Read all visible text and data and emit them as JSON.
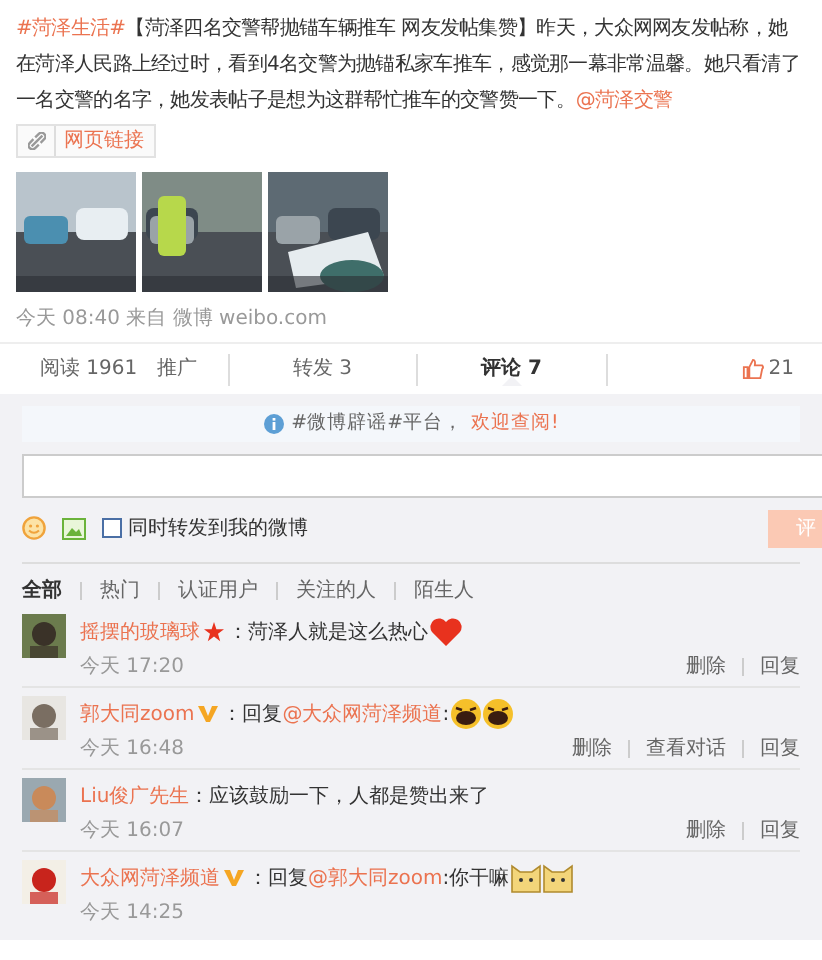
{
  "post": {
    "segments": [
      {
        "kind": "link",
        "text": "#菏泽生活#"
      },
      {
        "kind": "text",
        "text": "【菏泽四名交警帮抛锚车辆推车 网友发帖集赞】昨天，大众网网友发帖称，她在菏泽人民路上经过时，看到4名交警为抛锚私家车推车，感觉那一幕非常温馨。她只看清了一名交警的名字，她发表帖子是想为这群帮忙推车的交警赞一下。"
      },
      {
        "kind": "link",
        "text": "@菏泽交警"
      }
    ],
    "web_link": "网页链接",
    "meta": "今天 08:40 来自 微博 weibo.com"
  },
  "action_bar": {
    "reads": "阅读 1961",
    "promote": "推广",
    "tabs": [
      {
        "label": "转发 3",
        "selected": false
      },
      {
        "label": "评论 7",
        "selected": true
      }
    ],
    "likes": "21"
  },
  "notice": {
    "text": "#微博辟谣#平台，",
    "link": "欢迎查阅!"
  },
  "composer": {
    "repost_label": "同时转发到我的微博",
    "repost_checked": false,
    "submit": "评"
  },
  "filters": [
    {
      "label": "全部",
      "selected": true
    },
    {
      "label": "热门",
      "selected": false
    },
    {
      "label": "认证用户",
      "selected": false
    },
    {
      "label": "关注的人",
      "selected": false
    },
    {
      "label": "陌生人",
      "selected": false
    }
  ],
  "comments": [
    {
      "user": "摇摆的玻璃球",
      "badge": {
        "kind": "star"
      },
      "segments": [
        {
          "kind": "text",
          "text": "：菏泽人就是这么热心"
        }
      ],
      "emoji": [
        {
          "kind": "heart"
        }
      ],
      "time": "今天 17:20",
      "actions": [
        "删除",
        "回复"
      ]
    },
    {
      "user": "郭大同zoom",
      "badge": {
        "kind": "v"
      },
      "segments": [
        {
          "kind": "text",
          "text": "：回复"
        },
        {
          "kind": "link",
          "text": "@大众网菏泽频道"
        },
        {
          "kind": "text",
          "text": ":"
        }
      ],
      "emoji": [
        {
          "kind": "laugh"
        },
        {
          "kind": "laugh"
        }
      ],
      "time": "今天 16:48",
      "actions": [
        "删除",
        "查看对话",
        "回复"
      ]
    },
    {
      "user": "Liu俊广先生",
      "segments": [
        {
          "kind": "text",
          "text": "：应该鼓励一下，人都是赞出来了"
        }
      ],
      "time": "今天 16:07",
      "actions": [
        "删除",
        "回复"
      ]
    },
    {
      "user": "大众网菏泽频道",
      "badge": {
        "kind": "v"
      },
      "segments": [
        {
          "kind": "text",
          "text": "：回复"
        },
        {
          "kind": "link",
          "text": "@郭大同zoom"
        },
        {
          "kind": "text",
          "text": ":你干嘛"
        }
      ],
      "emoji": [
        {
          "kind": "cat"
        },
        {
          "kind": "cat"
        }
      ],
      "time": "今天 14:25"
    }
  ]
}
